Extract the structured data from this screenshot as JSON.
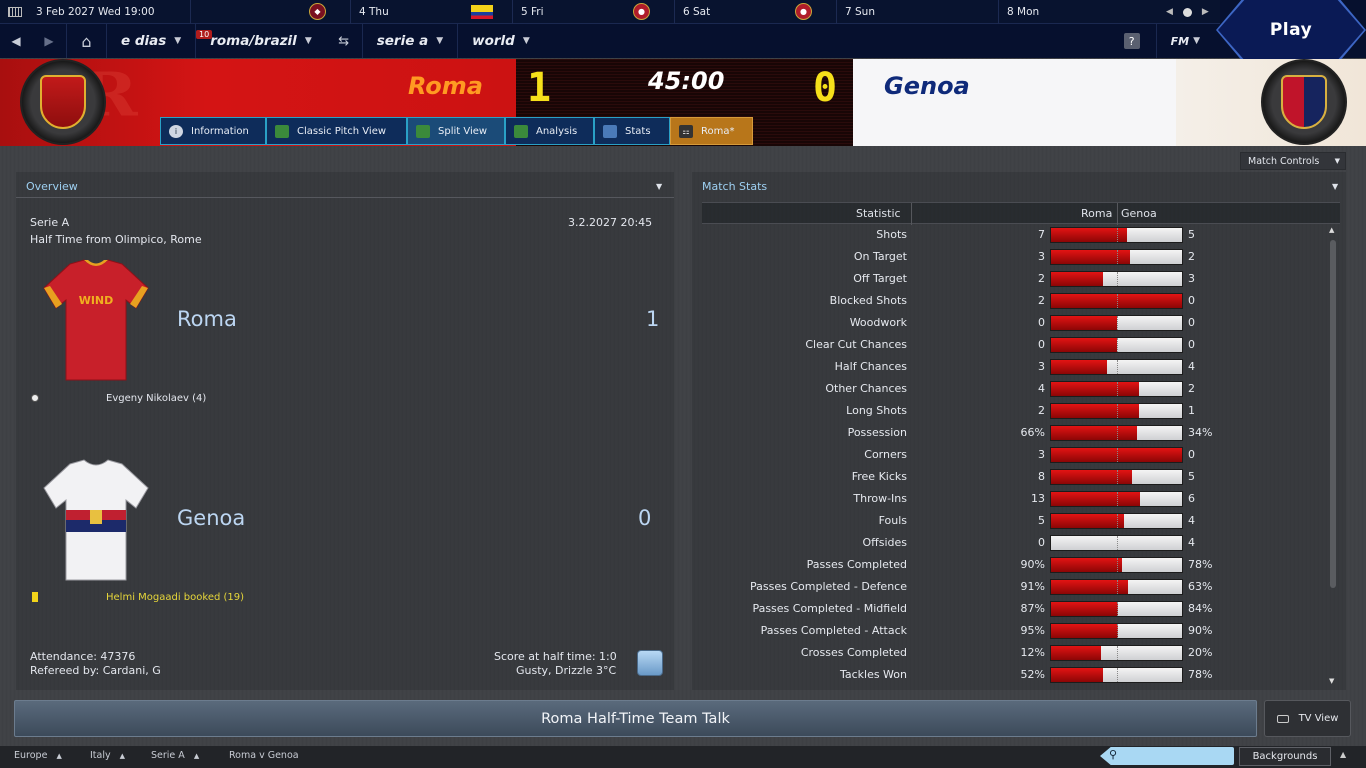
{
  "topbar": {
    "datetime": "3 Feb 2027 Wed 19:00",
    "calendar": [
      {
        "label": "4 Thu",
        "icon": "roma-crest"
      },
      {
        "label": "5 Fri",
        "icon": "ecuador-flag"
      },
      {
        "label": "6 Sat",
        "icon": "club-crest"
      },
      {
        "label": "7 Sun",
        "icon": "club-crest"
      },
      {
        "label": "8 Mon",
        "icon": "club-crest"
      }
    ],
    "nav": {
      "manager": "e dias",
      "team": "roma/brazil",
      "competition": "serie a",
      "world": "world",
      "inbox_count": "10",
      "help": "?",
      "fm_menu": "FM"
    },
    "play_label": "Play"
  },
  "match": {
    "home_name": "Roma",
    "away_name": "Genoa",
    "home_score": "1",
    "away_score": "0",
    "clock": "45:00",
    "home_color": "#d41414",
    "away_color": "#0f2a7a"
  },
  "tabs": [
    {
      "label": "Information",
      "icon": "info-icon"
    },
    {
      "label": "Classic Pitch View",
      "icon": "pitch-icon"
    },
    {
      "label": "Split View",
      "icon": "split-icon"
    },
    {
      "label": "Analysis",
      "icon": "analysis-icon"
    },
    {
      "label": "Stats",
      "icon": "stats-icon"
    },
    {
      "label": "Roma*",
      "icon": "tactics-icon"
    }
  ],
  "match_controls": "Match Controls",
  "overview": {
    "title": "Overview",
    "competition": "Serie A",
    "datetime": "3.2.2027 20:45",
    "venue": "Half Time from Olimpico, Rome",
    "home": {
      "name": "Roma",
      "score": "1",
      "event": "Evgeny Nikolaev (4)"
    },
    "away": {
      "name": "Genoa",
      "score": "0",
      "event": "Helmi Mogaadi booked (19)"
    },
    "attendance": "Attendance: 47376",
    "referee": "Refereed by: Cardani, G",
    "ht_score": "Score at half time: 1:0",
    "weather": "Gusty, Drizzle 3°C"
  },
  "stats": {
    "title": "Match Stats",
    "col_statistic": "Statistic",
    "col_home": "Roma",
    "col_away": "Genoa",
    "rows": [
      {
        "label": "Shots",
        "home": "7",
        "away": "5",
        "share": 0.58
      },
      {
        "label": "On Target",
        "home": "3",
        "away": "2",
        "share": 0.6
      },
      {
        "label": "Off Target",
        "home": "2",
        "away": "3",
        "share": 0.4
      },
      {
        "label": "Blocked Shots",
        "home": "2",
        "away": "0",
        "share": 1.0
      },
      {
        "label": "Woodwork",
        "home": "0",
        "away": "0",
        "share": 0.5
      },
      {
        "label": "Clear Cut Chances",
        "home": "0",
        "away": "0",
        "share": 0.5
      },
      {
        "label": "Half Chances",
        "home": "3",
        "away": "4",
        "share": 0.43
      },
      {
        "label": "Other Chances",
        "home": "4",
        "away": "2",
        "share": 0.67
      },
      {
        "label": "Long Shots",
        "home": "2",
        "away": "1",
        "share": 0.67
      },
      {
        "label": "Possession",
        "home": "66%",
        "away": "34%",
        "share": 0.66
      },
      {
        "label": "Corners",
        "home": "3",
        "away": "0",
        "share": 1.0
      },
      {
        "label": "Free Kicks",
        "home": "8",
        "away": "5",
        "share": 0.62
      },
      {
        "label": "Throw-Ins",
        "home": "13",
        "away": "6",
        "share": 0.68
      },
      {
        "label": "Fouls",
        "home": "5",
        "away": "4",
        "share": 0.56
      },
      {
        "label": "Offsides",
        "home": "0",
        "away": "4",
        "share": 0.0
      },
      {
        "label": "Passes Completed",
        "home": "90%",
        "away": "78%",
        "share": 0.54
      },
      {
        "label": "Passes Completed - Defence",
        "home": "91%",
        "away": "63%",
        "share": 0.59
      },
      {
        "label": "Passes Completed - Midfield",
        "home": "87%",
        "away": "84%",
        "share": 0.51
      },
      {
        "label": "Passes Completed - Attack",
        "home": "95%",
        "away": "90%",
        "share": 0.51
      },
      {
        "label": "Crosses Completed",
        "home": "12%",
        "away": "20%",
        "share": 0.38
      },
      {
        "label": "Tackles Won",
        "home": "52%",
        "away": "78%",
        "share": 0.4
      }
    ]
  },
  "team_talk": "Roma Half-Time Team Talk",
  "tv_view": "TV View",
  "breadcrumbs": [
    "Europe",
    "Italy",
    "Serie A",
    "Roma v Genoa"
  ],
  "backgrounds": "Backgrounds"
}
